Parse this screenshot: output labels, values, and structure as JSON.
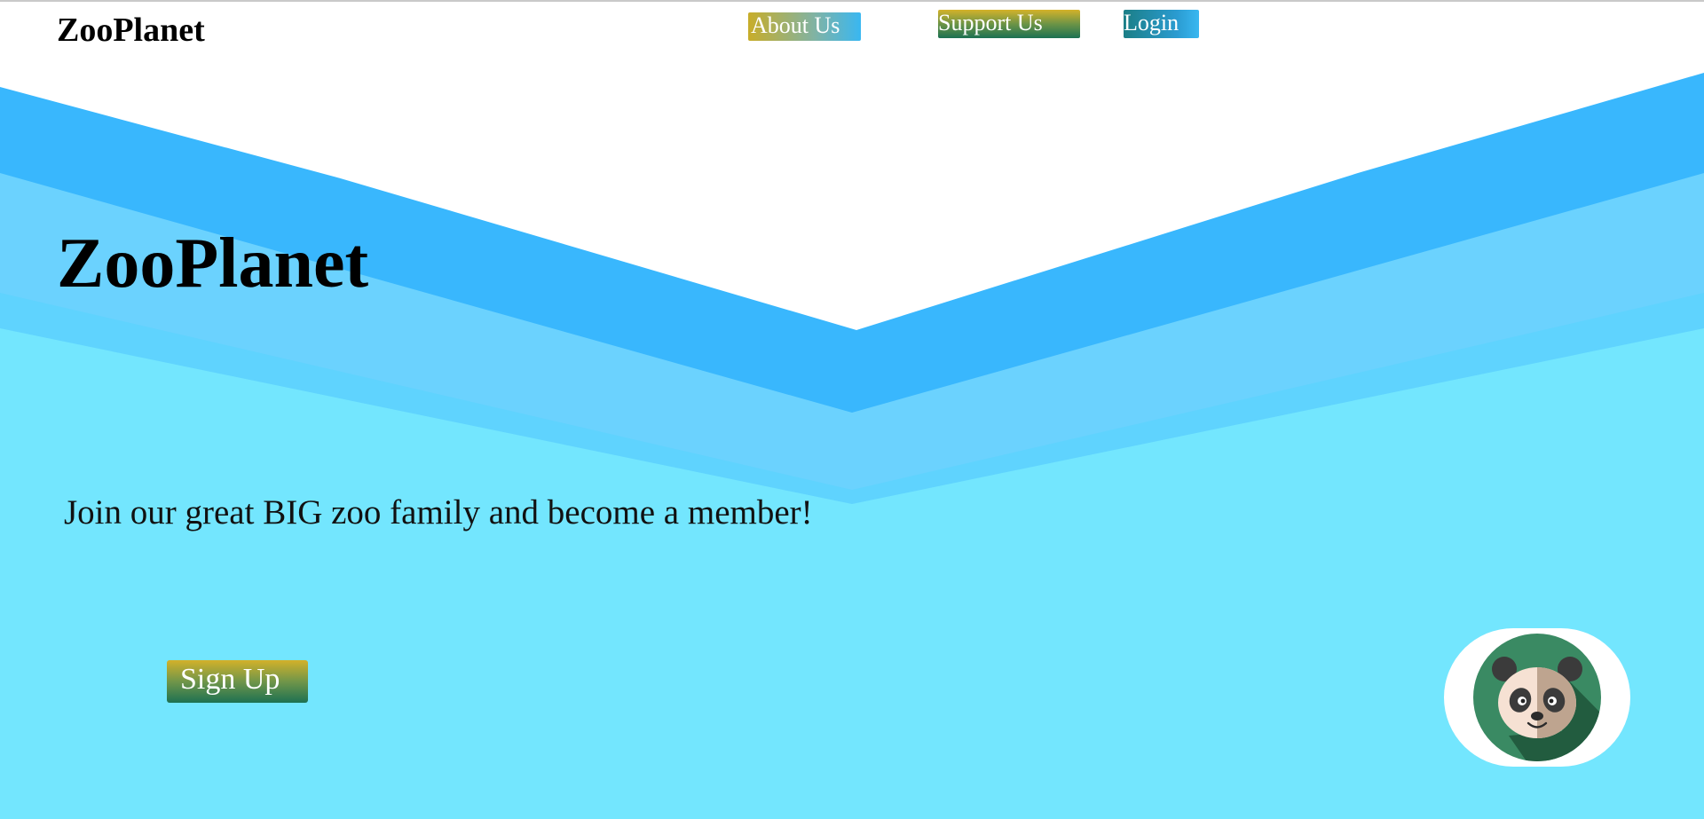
{
  "nav": {
    "brand": "ZooPlanet",
    "links": [
      {
        "label": "About Us"
      },
      {
        "label": "Support Us"
      },
      {
        "label": "Login"
      }
    ]
  },
  "hero": {
    "title": "ZooPlanet",
    "tagline": "Join our great BIG zoo family and become a member!",
    "signup_label": "Sign Up"
  },
  "mascot": {
    "icon": "panda-icon"
  },
  "colors": {
    "page_background": "#73e6fe",
    "wave_dark": "#39b7fd",
    "wave_mid": "#6bd2fe",
    "wave_light": "#5fd3fe",
    "mascot_circle": "#3a8a63"
  }
}
